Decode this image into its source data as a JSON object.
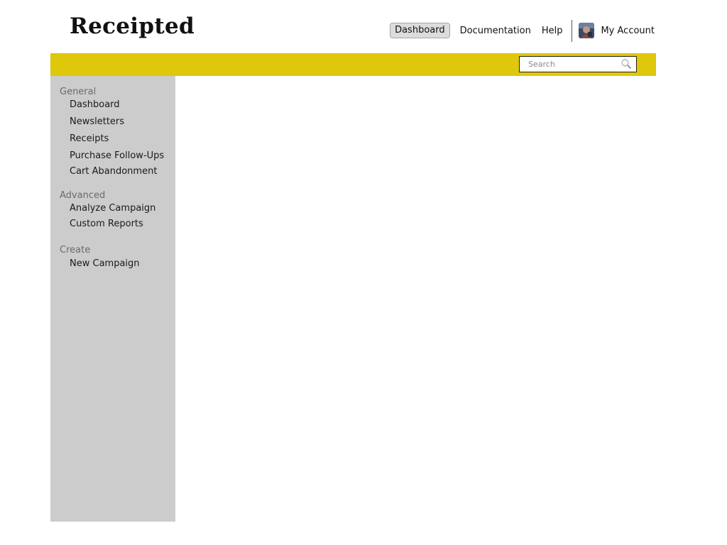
{
  "app": {
    "title": "Receipted"
  },
  "topnav": {
    "dashboard_label": "Dashboard",
    "documentation_label": "Documentation",
    "help_label": "Help",
    "account_label": "My Account",
    "active_item": "Dashboard"
  },
  "search": {
    "placeholder": "Search",
    "value": "",
    "icon": "magnifier-icon"
  },
  "sidebar": {
    "sections": [
      {
        "heading": "General",
        "items": [
          "Dashboard",
          "Newsletters",
          "Receipts",
          "Purchase Follow-Ups",
          "Cart Abandonment"
        ]
      },
      {
        "heading": "Advanced",
        "items": [
          "Analyze Campaign",
          "Custom Reports"
        ]
      },
      {
        "heading": "Create",
        "items": [
          "New Campaign"
        ]
      }
    ]
  },
  "colors": {
    "accent_bar": "#dfc70b",
    "sidebar_bg": "#cccccc",
    "active_tab_bg": "#dcdcdc",
    "heading_text": "#6a6a6a"
  }
}
